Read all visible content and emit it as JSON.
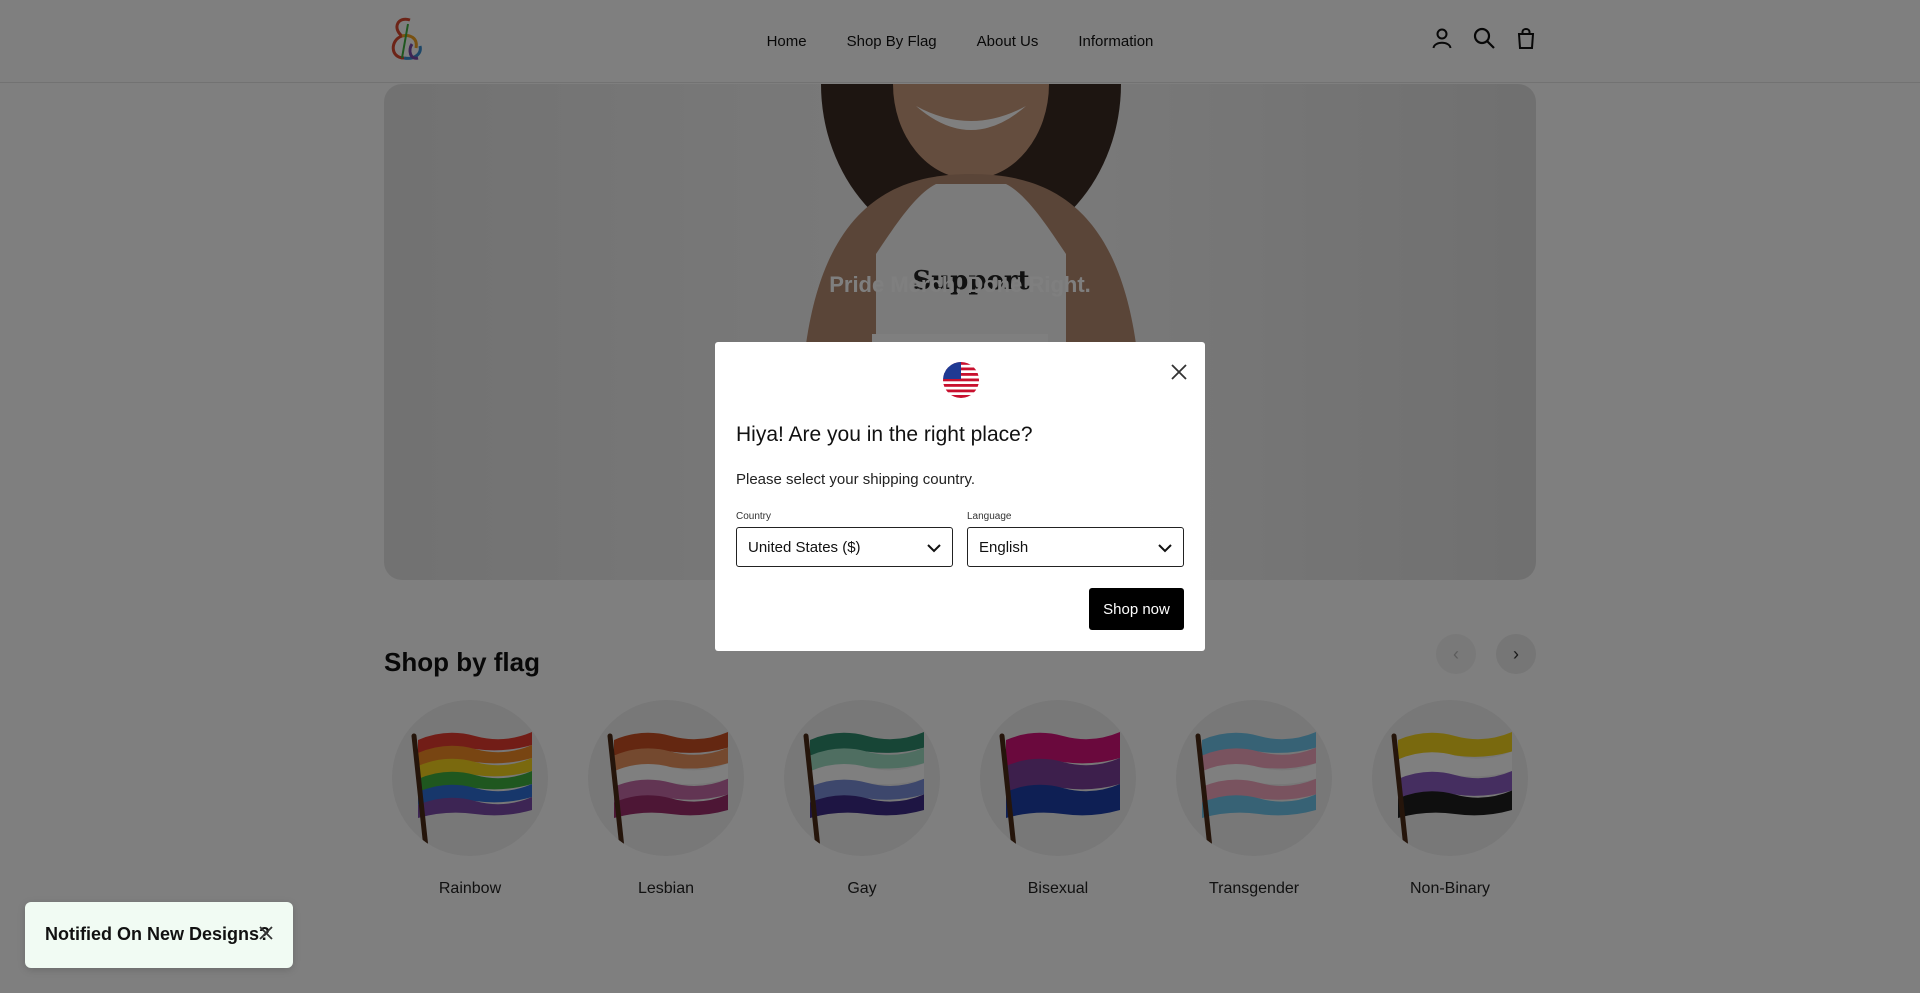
{
  "header": {
    "nav": [
      "Home",
      "Shop By Flag",
      "About Us",
      "Information"
    ],
    "icons": [
      "account-icon",
      "search-icon",
      "cart-icon"
    ]
  },
  "hero": {
    "title": "Pride Merch, Done Right.",
    "shirt_text": "Support"
  },
  "shop_by_flag": {
    "title": "Shop by flag",
    "prev": "‹",
    "next": "›",
    "items": [
      {
        "label": "Rainbow",
        "colors": [
          "#e53a2f",
          "#f08a24",
          "#f5d21c",
          "#3fae3f",
          "#2f6fd6",
          "#7a4aa8"
        ]
      },
      {
        "label": "Lesbian",
        "colors": [
          "#c94f23",
          "#e8935f",
          "#ffffff",
          "#c46ba6",
          "#9b2d6b"
        ]
      },
      {
        "label": "Gay",
        "colors": [
          "#2e8a6d",
          "#9fdcc2",
          "#ffffff",
          "#7a8fd8",
          "#3c2a86"
        ]
      },
      {
        "label": "Bisexual",
        "colors": [
          "#d4137a",
          "#7a3e98",
          "#1c3fa8"
        ]
      },
      {
        "label": "Transgender",
        "colors": [
          "#6ec5ea",
          "#f2a6be",
          "#ffffff",
          "#f2a6be",
          "#6ec5ea"
        ]
      },
      {
        "label": "Non-Binary",
        "colors": [
          "#f3d21c",
          "#ffffff",
          "#8a5cc0",
          "#1f1f1f"
        ]
      }
    ]
  },
  "modal": {
    "title": "Hiya! Are you in the right place?",
    "subtitle": "Please select your shipping country.",
    "country_label": "Country",
    "country_value": "United States ($)",
    "language_label": "Language",
    "language_value": "English",
    "button": "Shop now"
  },
  "notify": {
    "text": "Notified On New Designs?"
  }
}
